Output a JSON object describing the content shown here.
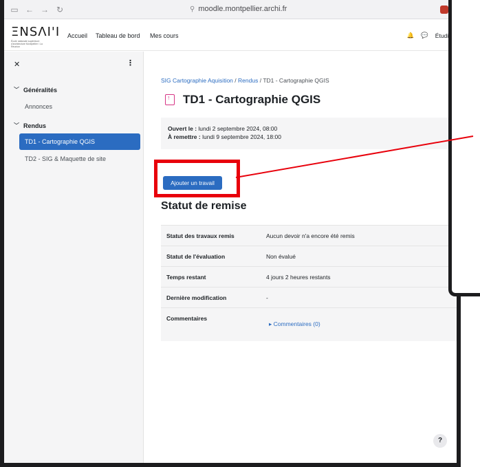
{
  "browser": {
    "url": "moodle.montpellier.archi.fr"
  },
  "navbar": {
    "logo_text": "ΞNSΛI'I",
    "logo_tagline": "École nationale supérieure d'architecture Montpellier / La Réunion",
    "links": [
      "Accueil",
      "Tableau de bord",
      "Mes cours"
    ],
    "user_label": "Étudiant"
  },
  "sidebar": {
    "sections": [
      {
        "label": "Généralités",
        "items": [
          "Annonces"
        ]
      },
      {
        "label": "Rendus",
        "items": [
          "TD1 - Cartographie QGIS",
          "TD2 - SIG & Maquette de site"
        ]
      }
    ],
    "active_item": "TD1 - Cartographie QGIS"
  },
  "main": {
    "breadcrumb": [
      "SIG Cartographie Aquisition",
      "Rendus",
      "TD1 - Cartographie QGIS"
    ],
    "breadcrumb_sep": "/",
    "title": "TD1 - Cartographie QGIS",
    "dates": {
      "open_label": "Ouvert le :",
      "open_value": "lundi 2 septembre 2024, 08:00",
      "due_label": "À remettre :",
      "due_value": "lundi 9 septembre 2024, 18:00"
    },
    "add_button": "Ajouter un travail",
    "status_heading": "Statut de remise",
    "status_rows": [
      {
        "key": "Statut des travaux remis",
        "value": "Aucun devoir n'a encore été remis"
      },
      {
        "key": "Statut de l'évaluation",
        "value": "Non évalué"
      },
      {
        "key": "Temps restant",
        "value": "4 jours 2 heures restants"
      },
      {
        "key": "Dernière modification",
        "value": "-"
      },
      {
        "key": "Commentaires",
        "value": "Commentaires (0)"
      }
    ],
    "help_label": "?"
  },
  "colors": {
    "accent": "#2b6cc1",
    "highlight": "#e8000b",
    "activity_icon": "#d63384"
  }
}
